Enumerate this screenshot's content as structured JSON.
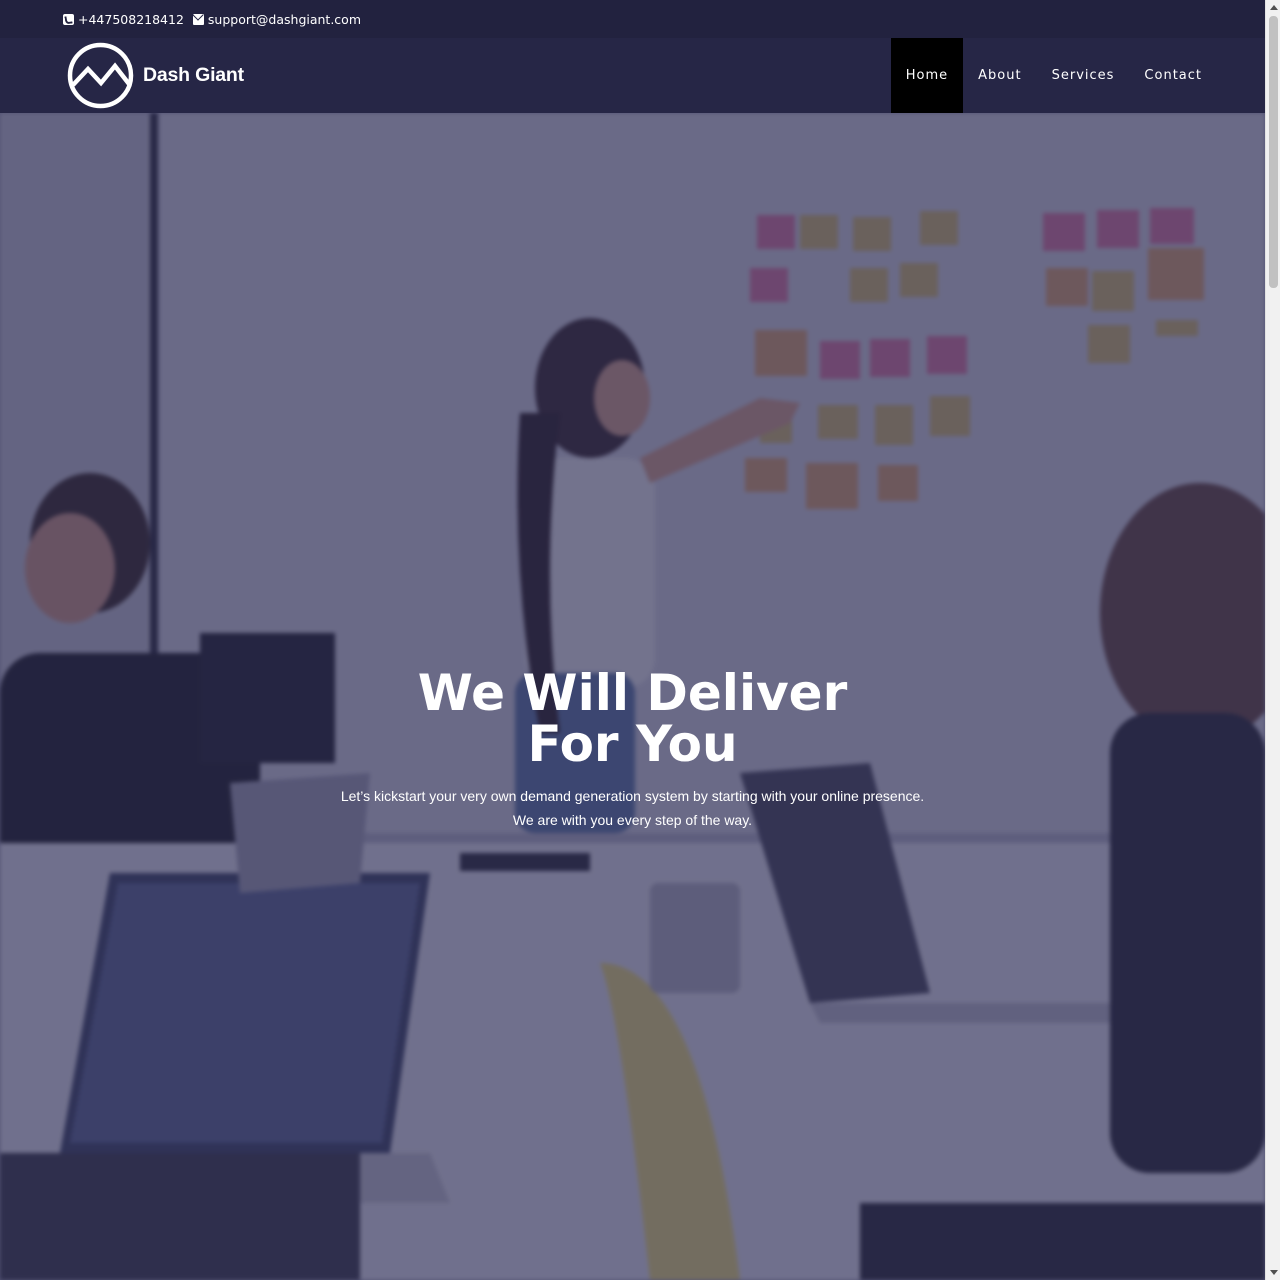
{
  "topbar": {
    "phone": "+447508218412",
    "email": "support@dashgiant.com",
    "phone_icon": "phone-square-icon",
    "email_icon": "envelope-icon"
  },
  "brand": {
    "name": "Dash Giant",
    "logo_icon": "mountain-circle-logo"
  },
  "nav": {
    "items": [
      {
        "label": "Home",
        "active": true
      },
      {
        "label": "About",
        "active": false
      },
      {
        "label": "Services",
        "active": false
      },
      {
        "label": "Contact",
        "active": false
      }
    ]
  },
  "hero": {
    "title_line1": "We Will Deliver",
    "title_line2": "For You",
    "subtitle_line1": "Let’s kickstart your very own demand generation system by starting with your online presence.",
    "subtitle_line2": "We are with you every step of the way."
  },
  "colors": {
    "header_bg": "#22223f",
    "navbar_bg": "#262646",
    "active_nav_bg": "#000000",
    "text": "#ffffff"
  }
}
